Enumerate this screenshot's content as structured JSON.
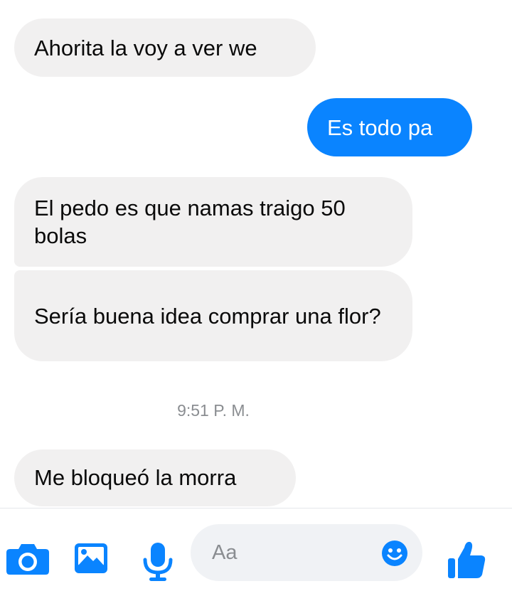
{
  "messages": [
    {
      "id": "m1",
      "direction": "incoming",
      "text": "Ahorita la voy a ver we"
    },
    {
      "id": "m2",
      "direction": "outgoing",
      "text": "Es todo pa"
    },
    {
      "id": "m3",
      "direction": "incoming",
      "text": "El pedo es que namas traigo 50 bolas"
    },
    {
      "id": "m4",
      "direction": "incoming",
      "text": "Sería buena idea comprar una flor?"
    },
    {
      "id": "m5",
      "direction": "incoming",
      "text": "Me bloqueó la morra"
    }
  ],
  "timestamp": "9:51 P. M.",
  "composer": {
    "placeholder": "Aa",
    "icons": [
      "camera-icon",
      "image-icon",
      "microphone-icon",
      "emoji-icon",
      "thumbs-up-icon"
    ]
  },
  "colors": {
    "accent": "#0a84ff",
    "incoming_bubble": "#f1f0f0",
    "timestamp_text": "#8a8d91"
  }
}
